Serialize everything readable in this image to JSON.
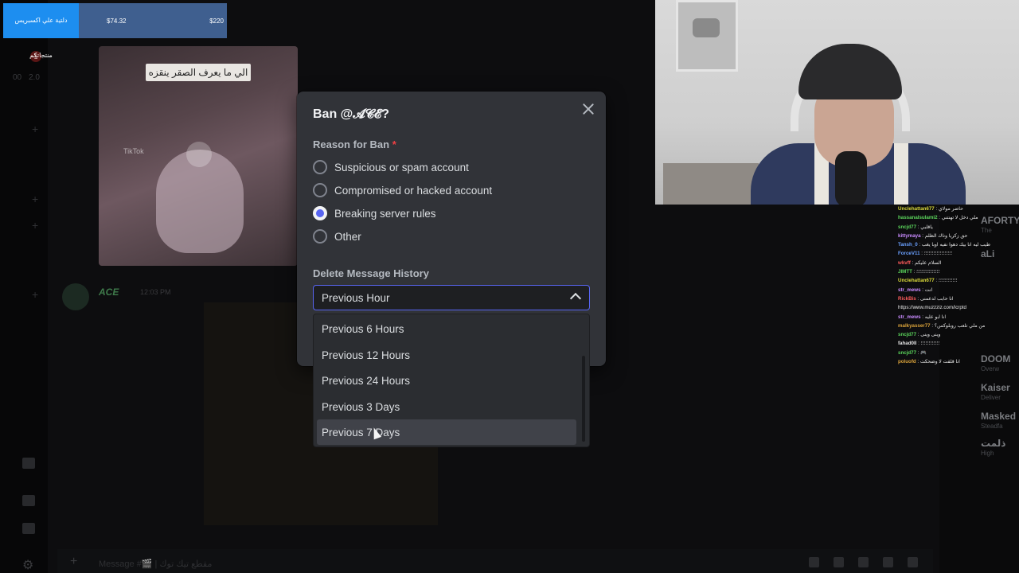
{
  "ticker": {
    "left_text": "دلتية علي اكسبريس منتجاتكم",
    "price1": "$74.32",
    "price2": "$220"
  },
  "background": {
    "rail_badge": "1",
    "rail_text_1": "00",
    "rail_text_2": "2.0",
    "video_caption": "الي ما يعرف الصقر ينقزه",
    "tiktok_mark": "TikTok",
    "message_author": "ACE",
    "message_time": "12:03 PM",
    "composer_placeholder": "Message #🎬 | مقطع تيك توك"
  },
  "modal": {
    "title": "Ban @𝓐𝓒𝓔?",
    "reason_label": "Reason for Ban",
    "required_mark": "*",
    "reasons": [
      {
        "label": "Suspicious or spam account",
        "checked": false
      },
      {
        "label": "Compromised or hacked account",
        "checked": false
      },
      {
        "label": "Breaking server rules",
        "checked": true
      },
      {
        "label": "Other",
        "checked": false
      }
    ],
    "history_label": "Delete Message History",
    "selected": "Previous Hour",
    "options": [
      "Previous 6 Hours",
      "Previous 12 Hours",
      "Previous 24 Hours",
      "Previous 3 Days",
      "Previous 7 Days"
    ],
    "hovered_option": "Previous 7 Days"
  },
  "chat": [
    {
      "user": "Unclehattan677",
      "color": "#d9d93a",
      "msg": "حاضر مولاي"
    },
    {
      "user": "hassanalsulami2",
      "color": "#5cd65c",
      "msg": "ملي دخل لا تهنتني"
    },
    {
      "user": "sncjd77",
      "color": "#5cd65c",
      "msg": "ياقلبي"
    },
    {
      "user": "kittymaya",
      "color": "#c98bff",
      "msg": "حق زكريا وناك الظلم"
    },
    {
      "user": "Tansh_0",
      "color": "#6aa0ff",
      "msg": "طيب ليه انا بيك دهوا نفيه اوبا يغب"
    },
    {
      "user": "ForceV11",
      "color": "#6aa0ff",
      "msg": "؛؛؛؛؛؛؛؛؛؛؛؛؛؛؛؛؛؛"
    },
    {
      "user": "wkvff",
      "color": "#ff5c5c",
      "msg": "السلام عليكم"
    },
    {
      "user": "JIMTT",
      "color": "#5cd65c",
      "msg": "؛؛؛؛؛؛؛؛؛؛؛؛؛؛؛"
    },
    {
      "user": "Unclehattan677",
      "color": "#d9d93a",
      "msg": "؛؛؛؛؛؛؛؛؛؛؛؛"
    },
    {
      "user": "str_mews",
      "color": "#c98bff",
      "msg": "انت"
    },
    {
      "user": "RickBis",
      "color": "#ff5c5c",
      "msg": "انا حابب لدعمنى"
    },
    {
      "user": "",
      "color": "#e8e8e8",
      "msg": "https://www.muzzziz.com/icrptd"
    },
    {
      "user": "str_mews",
      "color": "#c98bff",
      "msg": "انا ابو عليه"
    },
    {
      "user": "malkyasser77",
      "color": "#d9a23a",
      "msg": "من ملي تلعب روبلوكس؟"
    },
    {
      "user": "sncjd77",
      "color": "#5cd65c",
      "msg": "وينى وينى"
    },
    {
      "user": "fahad0ll",
      "color": "#e8e8e8",
      "msg": "؛؛؛؛؛؛؛؛؛؛؛؛"
    },
    {
      "user": "sncjd77",
      "color": "#5cd65c",
      "msg": "🎮"
    },
    {
      "user": "poluofd",
      "color": "#d9a23a",
      "msg": "انا قلقت لا وضحكت"
    }
  ],
  "members": [
    {
      "name": "AFORTY",
      "sub": "The"
    },
    {
      "name": "aLi",
      "sub": ""
    },
    {
      "name": "DOOM",
      "sub": "Overw"
    },
    {
      "name": "Kaiser",
      "sub": "Deliver"
    },
    {
      "name": "Masked",
      "sub": "Steadfa"
    },
    {
      "name": "ذلمت",
      "sub": "High"
    }
  ],
  "colors": {
    "accent": "#5865f2",
    "modal_bg": "#313338",
    "input_bg": "#1e1f22"
  }
}
